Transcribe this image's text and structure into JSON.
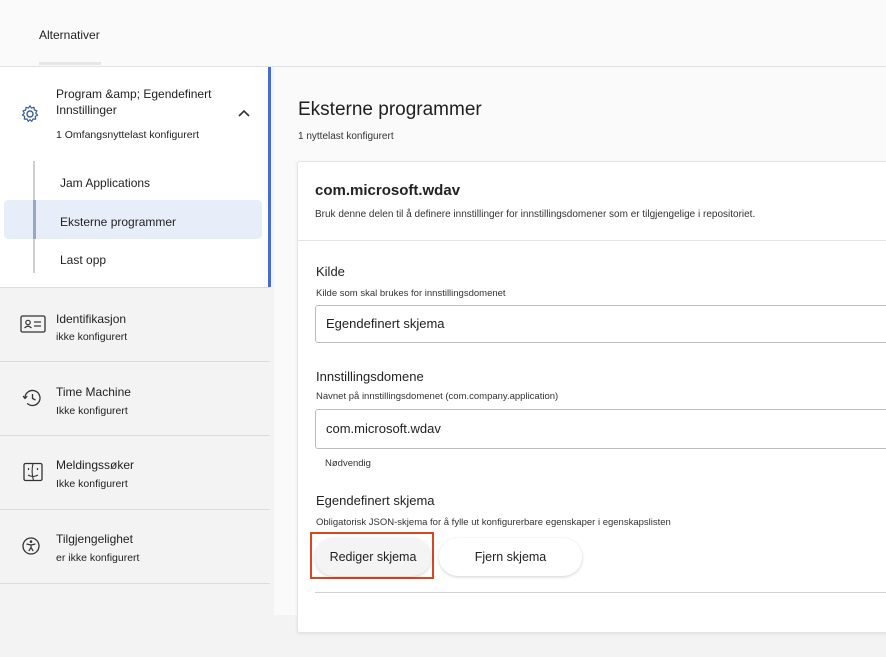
{
  "topbar": {
    "tab_label": "Alternativer"
  },
  "sidebar": {
    "active": {
      "title": "Program &amp; Egendefinert Innstillinger",
      "subtitle": "1 Omfangsnyttelast konfigurert",
      "children": [
        "Jam Applications",
        "Eksterne programmer",
        "Last opp"
      ]
    },
    "items": [
      {
        "name": "Identifikasjon",
        "status": "ikke konfigurert",
        "icon": "id-card-icon"
      },
      {
        "name": "Time Machine",
        "status": "Ikke konfigurert",
        "icon": "history-clock-icon"
      },
      {
        "name": "Meldingssøker",
        "status": "Ikke konfigurert",
        "icon": "finder-icon"
      },
      {
        "name": "Tilgjengelighet",
        "status": "er ikke konfigurert",
        "icon": "accessibility-icon"
      }
    ]
  },
  "main": {
    "title": "Eksterne programmer",
    "subtitle": "1 nyttelast konfigurert",
    "card": {
      "title": "com.microsoft.wdav",
      "description": "Bruk denne delen til å definere innstillinger for innstillingsdomener som er tilgjengelige i repositoriet.",
      "source": {
        "label": "Kilde",
        "help": "Kilde som skal brukes for innstillingsdomenet",
        "value": "Egendefinert skjema"
      },
      "domain": {
        "label": "Innstillingsdomene",
        "help": "Navnet på innstillingsdomenet (com.company.application)",
        "value": "com.microsoft.wdav",
        "required": "Nødvendig"
      },
      "schema": {
        "label": "Egendefinert skjema",
        "help": "Obligatorisk JSON-skjema for å fylle ut konfigurerbare egenskaper i egenskapslisten",
        "edit_button": "Rediger skjema",
        "remove_button": "Fjern skjema"
      }
    }
  },
  "colors": {
    "accent": "#3d6ee0",
    "highlight": "#d9461f",
    "selected_bg": "#e8eef9"
  }
}
